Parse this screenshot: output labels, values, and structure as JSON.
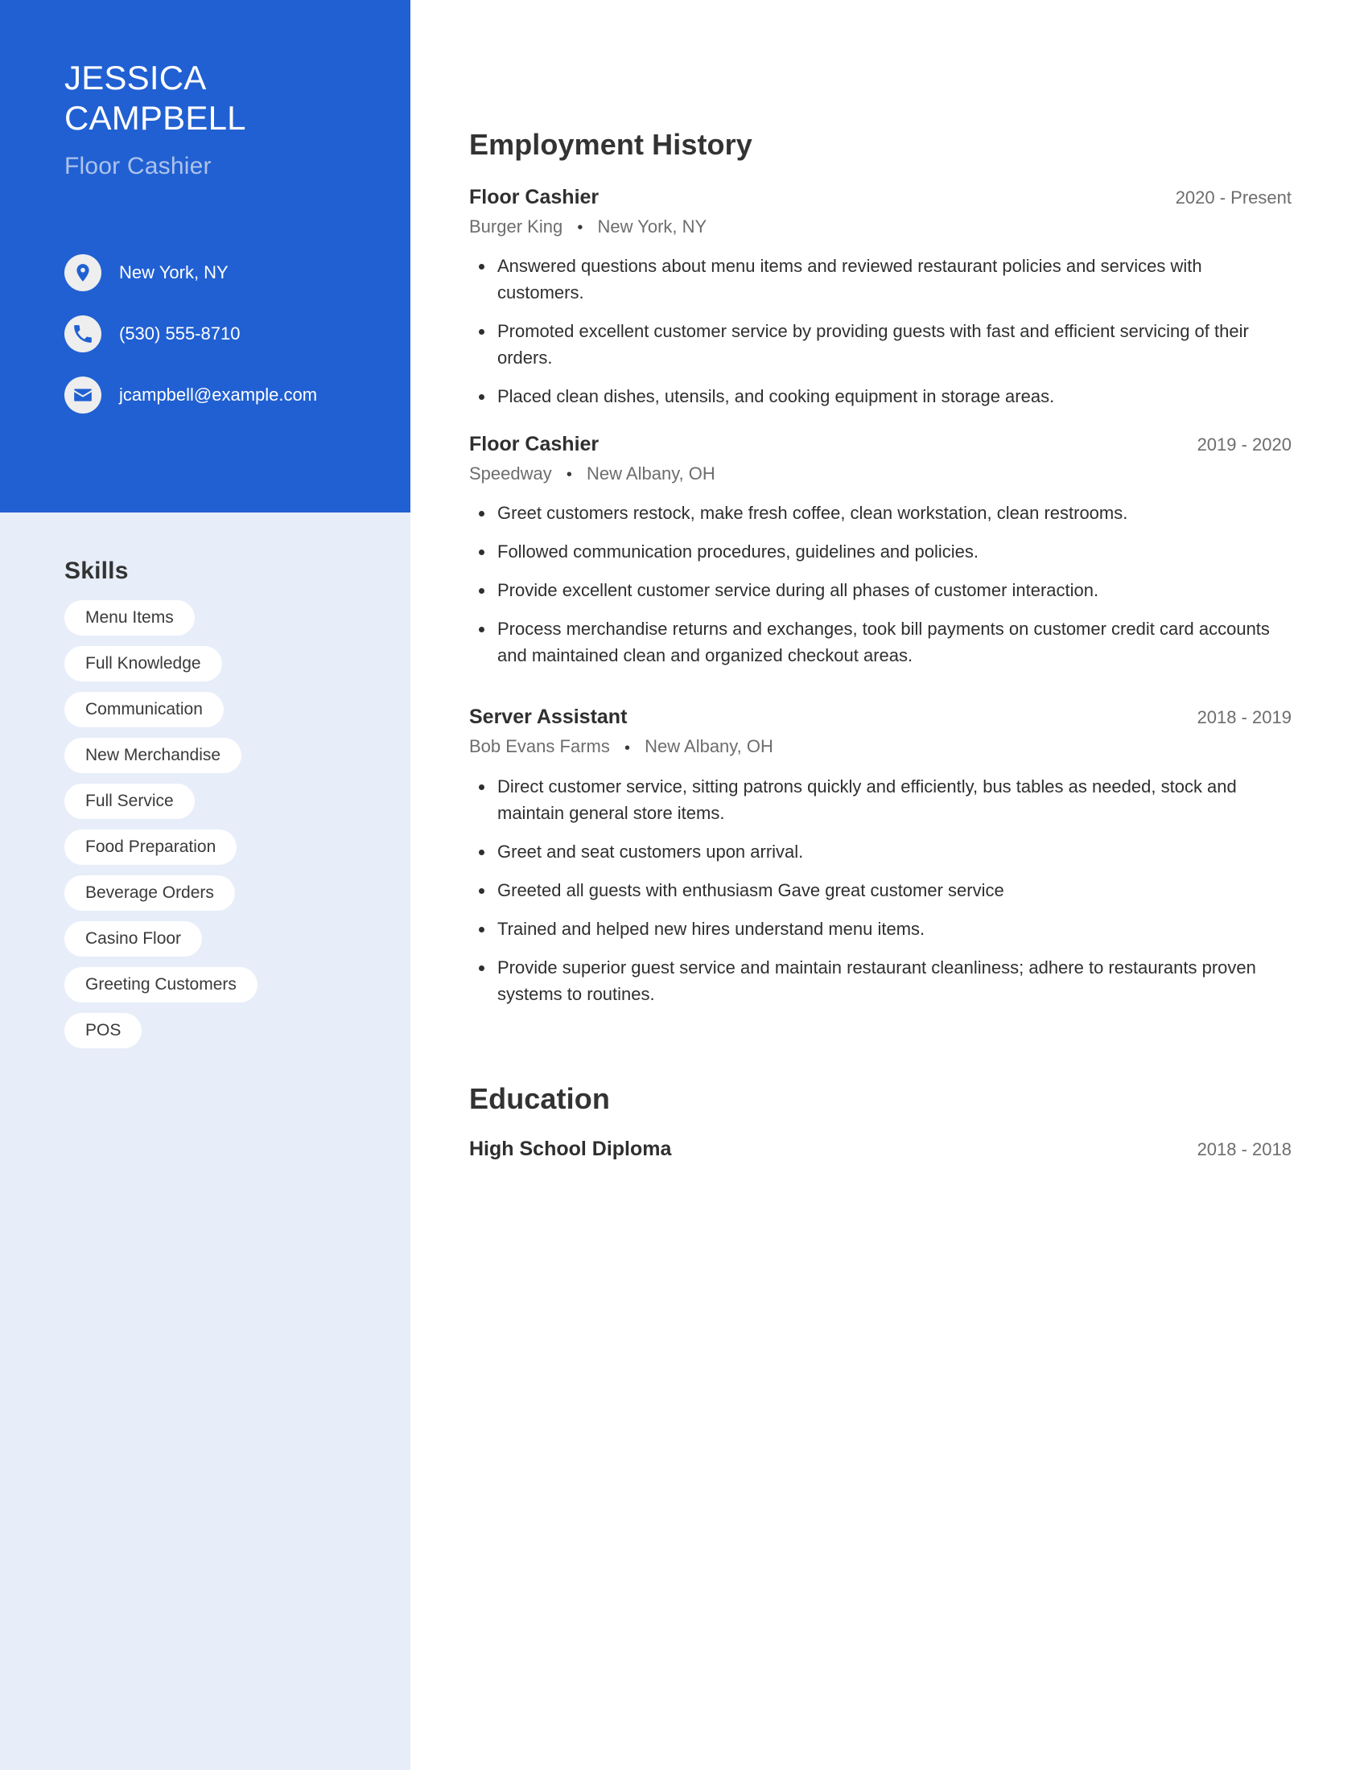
{
  "theme": {
    "accent": "#2160d2",
    "sidebar_bg": "#e7edf9",
    "heading_color": "#333333",
    "muted_text": "#6d6d6d",
    "subtitle_color": "#adc3ec"
  },
  "header": {
    "first_name": "JESSICA",
    "last_name": "CAMPBELL",
    "job_title": "Floor Cashier",
    "contacts": [
      {
        "icon": "location-pin-icon",
        "value": "New York, NY"
      },
      {
        "icon": "phone-icon",
        "value": "(530) 555-8710"
      },
      {
        "icon": "envelope-icon",
        "value": "jcampbell@example.com"
      }
    ]
  },
  "skills": {
    "heading": "Skills",
    "items": [
      "Menu Items",
      "Full Knowledge",
      "Communication",
      "New Merchandise",
      "Full Service",
      "Food Preparation",
      "Beverage Orders",
      "Casino Floor",
      "Greeting Customers",
      "POS"
    ]
  },
  "employment": {
    "heading": "Employment History",
    "entries": [
      {
        "title": "Floor Cashier",
        "dates": "2020 - Present",
        "company": "Burger King",
        "location": "New York, NY",
        "bullets": [
          "Answered questions about menu items and reviewed restaurant policies and services with customers.",
          "Promoted excellent customer service by providing guests with fast and efficient servicing of their orders.",
          "Placed clean dishes, utensils, and cooking equipment in storage areas."
        ]
      },
      {
        "title": "Floor Cashier",
        "dates": "2019 - 2020",
        "company": "Speedway",
        "location": "New Albany, OH",
        "bullets": [
          "Greet customers restock, make fresh coffee, clean workstation, clean restrooms.",
          "Followed communication procedures, guidelines and policies.",
          "Provide excellent customer service during all phases of customer interaction.",
          "Process merchandise returns and exchanges, took bill payments on customer credit card accounts and maintained clean and organized checkout areas."
        ]
      },
      {
        "title": "Server Assistant",
        "dates": "2018 - 2019",
        "company": "Bob Evans Farms",
        "location": "New Albany, OH",
        "bullets": [
          "Direct customer service, sitting patrons quickly and efficiently, bus tables as needed, stock and maintain general store items.",
          "Greet and seat customers upon arrival.",
          "Greeted all guests with enthusiasm Gave great customer service",
          "Trained and helped new hires understand menu items.",
          "Provide superior guest service and maintain restaurant cleanliness; adhere to restaurants proven systems to routines."
        ]
      }
    ]
  },
  "education": {
    "heading": "Education",
    "entries": [
      {
        "title": "High School Diploma",
        "dates": "2018 - 2018"
      }
    ]
  },
  "separator": "•"
}
